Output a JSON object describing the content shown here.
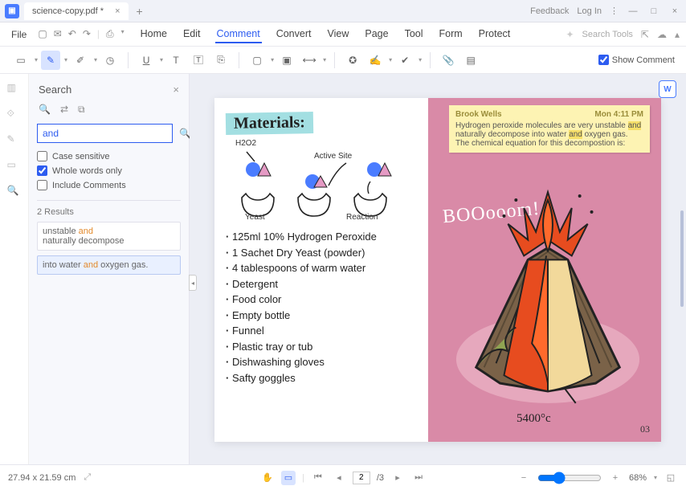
{
  "tab": {
    "title": "science-copy.pdf *"
  },
  "title_right": {
    "feedback": "Feedback",
    "login": "Log In"
  },
  "menu": {
    "file": "File"
  },
  "main_tabs": [
    "Home",
    "Edit",
    "Comment",
    "Convert",
    "View",
    "Page",
    "Tool",
    "Form",
    "Protect"
  ],
  "active_tab_index": 2,
  "search_tools_placeholder": "Search Tools",
  "show_comment_label": "Show Comment",
  "search": {
    "title": "Search",
    "value": "and",
    "opt_case": "Case sensitive",
    "opt_whole": "Whole words only",
    "opt_comments": "Include Comments",
    "results_label": "2 Results",
    "r1_pre": "unstable ",
    "r1_hl": "and",
    "r1_post": "",
    "r1b": "naturally decompose",
    "r2_pre": "into water ",
    "r2_hl": "and",
    "r2_post": " oxygen gas."
  },
  "doc": {
    "materials_title": "Materials:",
    "diagram_labels": {
      "h2o2": "H2O2",
      "active": "Active Site",
      "yeast": "Yeast",
      "reaction": "Reaction"
    },
    "list": [
      "125ml 10% Hydrogen Peroxide",
      "1 Sachet Dry Yeast (powder)",
      "4 tablespoons of warm water",
      "Detergent",
      "Food color",
      "Empty bottle",
      "Funnel",
      "Plastic tray or tub",
      "Dishwashing gloves",
      "Safty goggles"
    ],
    "note": {
      "author": "Brook Wells",
      "time": "Mon 4:11 PM",
      "t1": "Hydrogen peroxide molecules are very unstable ",
      "h1": "and",
      "t2": " naturally decompose into water ",
      "h2": "and",
      "t3": " oxygen gas. The chemical equation for this decompostion is:"
    },
    "boom": "BOOooom!",
    "temp": "5400°c",
    "pagenum": "03"
  },
  "status": {
    "dims": "27.94 x 21.59 cm",
    "cur_page": "2",
    "total": "/3",
    "zoom": "68%"
  }
}
